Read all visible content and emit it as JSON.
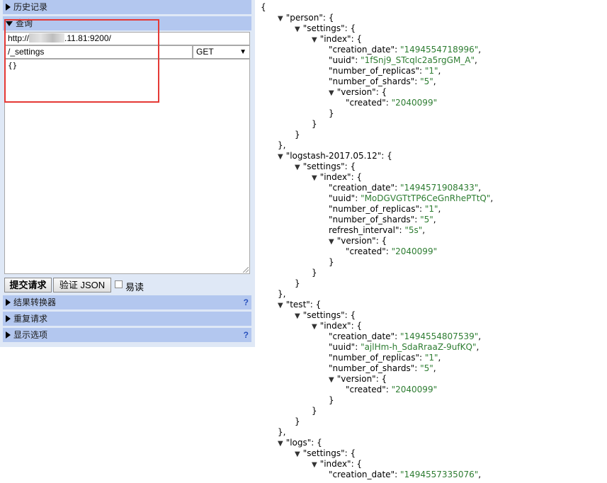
{
  "sidebar": {
    "history_label": "历史记录",
    "query_label": "查询",
    "url_value_prefix": "http://",
    "url_value_suffix": ".11.81:9200/",
    "path_value": "/_settings",
    "method_value": "GET",
    "body_value": "{}",
    "submit_label": "提交请求",
    "validate_label": "验证 JSON",
    "easy_read_label": "易读",
    "result_transformer_label": "结果转换器",
    "repeat_request_label": "重复请求",
    "display_options_label": "显示选项",
    "help_glyph": "?"
  },
  "json_view": {
    "lines": [
      {
        "indent": 0,
        "text": "{",
        "tog": false
      },
      {
        "indent": 1,
        "key": "\"person\"",
        "after": ": {",
        "tog": true
      },
      {
        "indent": 2,
        "key": "\"settings\"",
        "after": ": {",
        "tog": true
      },
      {
        "indent": 3,
        "key": "\"index\"",
        "after": ": {",
        "tog": true
      },
      {
        "indent": 4,
        "key": "\"creation_date\"",
        "sep": ": ",
        "str": "\"1494554718996\"",
        "tail": ","
      },
      {
        "indent": 4,
        "key": "\"uuid\"",
        "sep": ": ",
        "str": "\"1fSnj9_STcqlc2a5rgGM_A\"",
        "tail": ","
      },
      {
        "indent": 4,
        "key": "\"number_of_replicas\"",
        "sep": ": ",
        "str": "\"1\"",
        "tail": ","
      },
      {
        "indent": 4,
        "key": "\"number_of_shards\"",
        "sep": ": ",
        "str": "\"5\"",
        "tail": ","
      },
      {
        "indent": 4,
        "key": "\"version\"",
        "after": ": {",
        "tog": true
      },
      {
        "indent": 5,
        "key": "\"created\"",
        "sep": ": ",
        "str": "\"2040099\"",
        "tail": ""
      },
      {
        "indent": 4,
        "text": "}"
      },
      {
        "indent": 3,
        "text": "}"
      },
      {
        "indent": 2,
        "text": "}"
      },
      {
        "indent": 1,
        "text": "},"
      },
      {
        "indent": 1,
        "key": "\"logstash-2017.05.12\"",
        "after": ": {",
        "tog": true
      },
      {
        "indent": 2,
        "key": "\"settings\"",
        "after": ": {",
        "tog": true
      },
      {
        "indent": 3,
        "key": "\"index\"",
        "after": ": {",
        "tog": true
      },
      {
        "indent": 4,
        "key": "\"creation_date\"",
        "sep": ": ",
        "str": "\"1494571908433\"",
        "tail": ","
      },
      {
        "indent": 4,
        "key": "\"uuid\"",
        "sep": ": ",
        "str": "\"MoDGVGTtTP6CeGnRhePTtQ\"",
        "tail": ","
      },
      {
        "indent": 4,
        "key": "\"number_of_replicas\"",
        "sep": ": ",
        "str": "\"1\"",
        "tail": ","
      },
      {
        "indent": 4,
        "key": "\"number_of_shards\"",
        "sep": ": ",
        "str": "\"5\"",
        "tail": ","
      },
      {
        "indent": 4,
        "key": "refresh_interval\"",
        "sep": ": ",
        "str": "\"5s\"",
        "tail": ","
      },
      {
        "indent": 4,
        "key": "\"version\"",
        "after": ": {",
        "tog": true
      },
      {
        "indent": 5,
        "key": "\"created\"",
        "sep": ": ",
        "str": "\"2040099\"",
        "tail": ""
      },
      {
        "indent": 4,
        "text": "}"
      },
      {
        "indent": 3,
        "text": "}"
      },
      {
        "indent": 2,
        "text": "}"
      },
      {
        "indent": 1,
        "text": "},"
      },
      {
        "indent": 1,
        "key": "\"test\"",
        "after": ": {",
        "tog": true
      },
      {
        "indent": 2,
        "key": "\"settings\"",
        "after": ": {",
        "tog": true
      },
      {
        "indent": 3,
        "key": "\"index\"",
        "after": ": {",
        "tog": true
      },
      {
        "indent": 4,
        "key": "\"creation_date\"",
        "sep": ": ",
        "str": "\"1494554807539\"",
        "tail": ","
      },
      {
        "indent": 4,
        "key": "\"uuid\"",
        "sep": ": ",
        "str": "\"ajlHm-h_SdaRraaZ-9ufKQ\"",
        "tail": ","
      },
      {
        "indent": 4,
        "key": "\"number_of_replicas\"",
        "sep": ": ",
        "str": "\"1\"",
        "tail": ","
      },
      {
        "indent": 4,
        "key": "\"number_of_shards\"",
        "sep": ": ",
        "str": "\"5\"",
        "tail": ","
      },
      {
        "indent": 4,
        "key": "\"version\"",
        "after": ": {",
        "tog": true
      },
      {
        "indent": 5,
        "key": "\"created\"",
        "sep": ": ",
        "str": "\"2040099\"",
        "tail": ""
      },
      {
        "indent": 4,
        "text": "}"
      },
      {
        "indent": 3,
        "text": "}"
      },
      {
        "indent": 2,
        "text": "}"
      },
      {
        "indent": 1,
        "text": "},"
      },
      {
        "indent": 1,
        "key": "\"logs\"",
        "after": ": {",
        "tog": true
      },
      {
        "indent": 2,
        "key": "\"settings\"",
        "after": ": {",
        "tog": true
      },
      {
        "indent": 3,
        "key": "\"index\"",
        "after": ": {",
        "tog": true
      },
      {
        "indent": 4,
        "key": "\"creation_date\"",
        "sep": ": ",
        "str": "\"1494557335076\"",
        "tail": ","
      }
    ]
  }
}
